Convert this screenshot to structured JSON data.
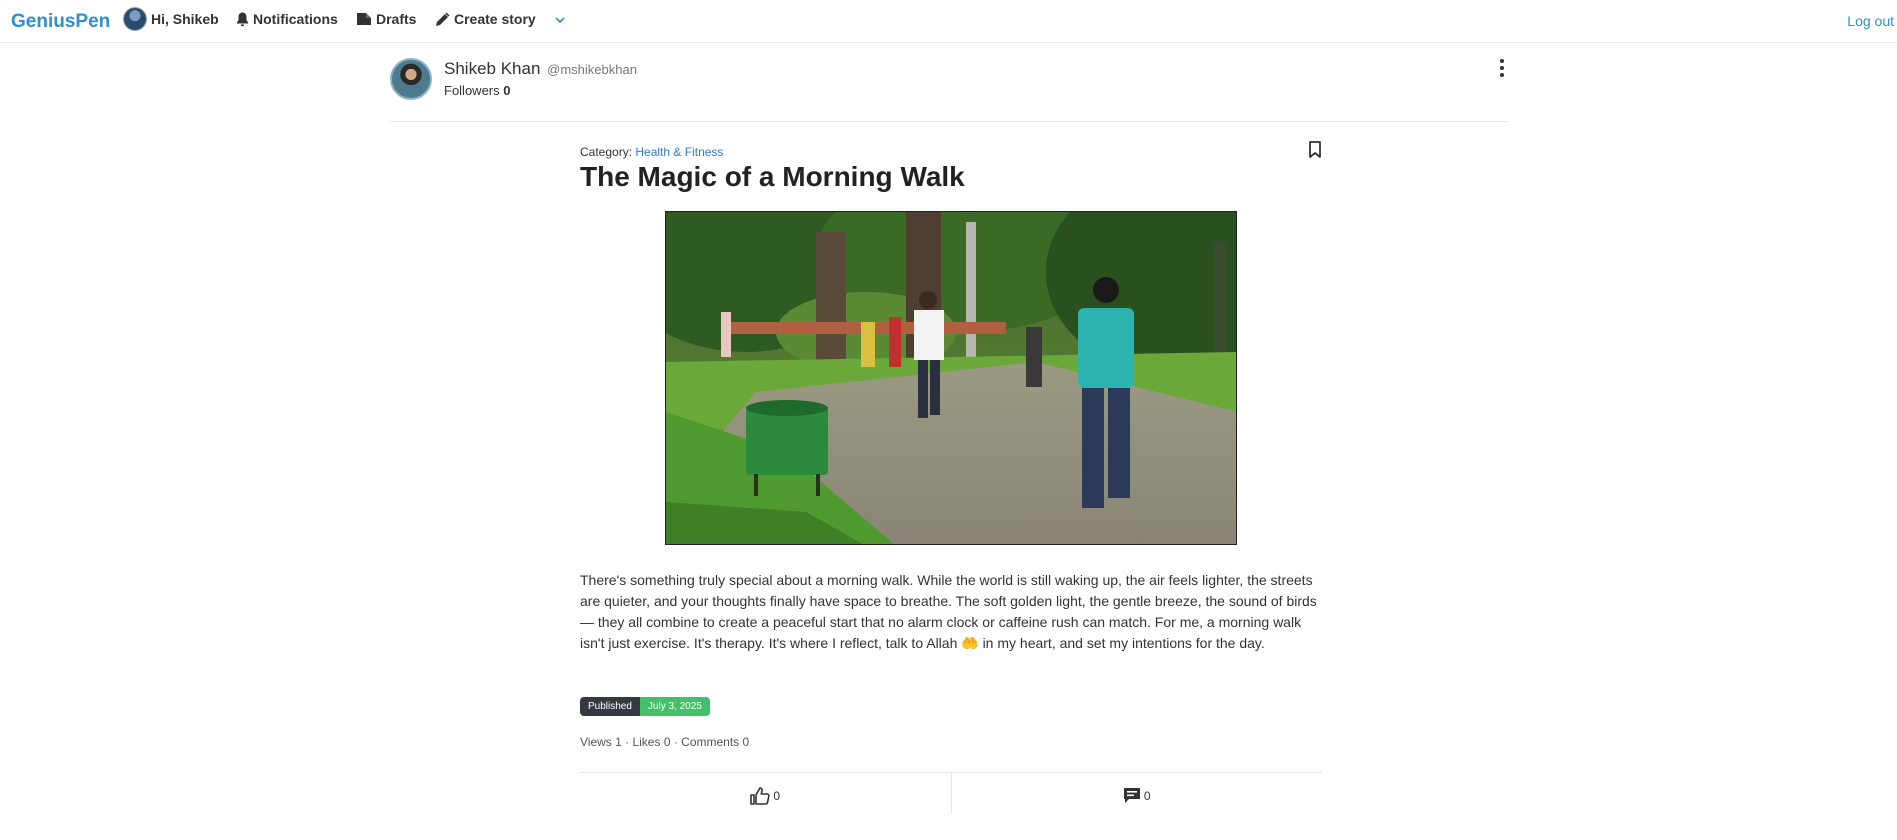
{
  "nav": {
    "brand": "GeniusPen",
    "greeting": "Hi, Shikeb",
    "notifications": "Notifications",
    "drafts": "Drafts",
    "create_story": "Create story",
    "logout": "Log out"
  },
  "author": {
    "name": "Shikeb Khan",
    "handle": "@mshikebkhan",
    "followers_label": "Followers",
    "followers_count": "0"
  },
  "article": {
    "category_label": "Category:",
    "category": "Health & Fitness",
    "title": "The Magic of a Morning Walk",
    "body": "There's something truly special about a morning walk. While the world is still waking up, the air feels lighter, the streets are quieter, and your thoughts finally have space to breathe. The soft golden light, the gentle breeze, the sound of birds — they all combine to create a peaceful start that no alarm clock or caffeine rush can match. For me, a morning walk isn't just exercise. It's therapy. It's where I reflect, talk to Allah 🤲 in my heart, and set my intentions for the day.",
    "status": "Published",
    "date": "July 3, 2025",
    "stats": "Views 1 · Likes 0 · Comments 0",
    "like_count": "0",
    "comment_count": "0"
  },
  "icons": {
    "bell": "bell-icon",
    "drafts": "drafts-icon",
    "pencil": "pencil-icon",
    "chevron": "chevron-down-icon",
    "kebab": "more-vertical-icon",
    "bookmark": "bookmark-icon",
    "like": "thumbs-up-icon",
    "comment": "comment-icon"
  },
  "colors": {
    "brand": "#2f8fd0",
    "link": "#2f7bd0",
    "badge_dark": "#343a40",
    "badge_green": "#42c16a"
  }
}
